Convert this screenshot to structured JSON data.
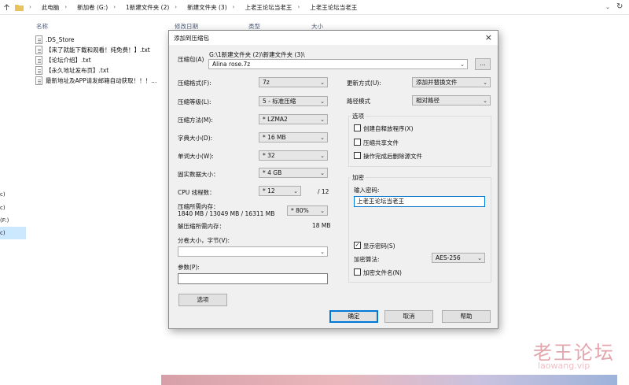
{
  "explorer": {
    "breadcrumb": [
      "此电脑",
      "新加卷 (G:)",
      "1新建文件夹 (2)",
      "新建文件夹 (3)",
      "上老王论坛当老王",
      "上老王论坛当老王"
    ],
    "columns": {
      "name": "名称",
      "modified": "修改日期",
      "type": "类型",
      "size": "大小"
    },
    "files": [
      ".DS_Store",
      "【来了就能下载和观看！纯免费！】.txt",
      "【论坛介绍】.txt",
      "【永久地址发布页】.txt",
      "最新地址及APP请发邮箱自动获取！！！..."
    ],
    "nav_ticks": [
      "c)",
      "c)",
      "(F:)",
      "c)"
    ]
  },
  "watermark": {
    "cn": "老王论坛",
    "en": "laowang.vip"
  },
  "dialog": {
    "title": "添加到压缩包",
    "close": "×",
    "archive": {
      "label": "压缩包(A)",
      "path": "G:\\1新建文件夹 (2)\\新建文件夹 (3)\\",
      "name": "Alina rose.7z",
      "browse": "..."
    },
    "left": {
      "format": {
        "label": "压缩格式(F):",
        "value": "7z"
      },
      "level": {
        "label": "压缩等级(L):",
        "value": "5 - 标准压缩"
      },
      "method": {
        "label": "压缩方法(M):",
        "value": "* LZMA2"
      },
      "dict": {
        "label": "字典大小(D):",
        "value": "* 16 MB"
      },
      "word": {
        "label": "单词大小(W):",
        "value": "* 32"
      },
      "solid": {
        "label": "固实数据大小：",
        "value": "* 4 GB"
      },
      "cpu": {
        "label": "CPU 线程数：",
        "value": "* 12",
        "total": "/ 12"
      },
      "mem": {
        "label": "压缩所需内存：",
        "detail": "1840 MB / 13049 MB / 16311 MB",
        "value": "* 80%"
      },
      "decomp": {
        "label": "解压缩所需内存：",
        "value": "18 MB"
      },
      "split": {
        "label": "分卷大小，字节(V):",
        "value": ""
      },
      "params": {
        "label": "参数(P):",
        "value": ""
      },
      "options_btn": "选项"
    },
    "right": {
      "update": {
        "label": "更新方式(U):",
        "value": "添加并替换文件"
      },
      "pathmode": {
        "label": "路径模式",
        "value": "相对路径"
      },
      "options_title": "选项",
      "opt_sfx": "创建自释放程序(X)",
      "opt_share": "压缩共享文件",
      "opt_delete": "操作完成后删除源文件",
      "enc_title": "加密",
      "pwd_label": "输入密码:",
      "pwd_value": "上老王论坛当老王",
      "show_pwd": "显示密码(S)",
      "show_pwd_check": "✓",
      "enc_method": {
        "label": "加密算法:",
        "value": "AES-256"
      },
      "enc_names": "加密文件名(N)"
    },
    "buttons": {
      "ok": "确定",
      "cancel": "取消",
      "help": "帮助"
    }
  }
}
